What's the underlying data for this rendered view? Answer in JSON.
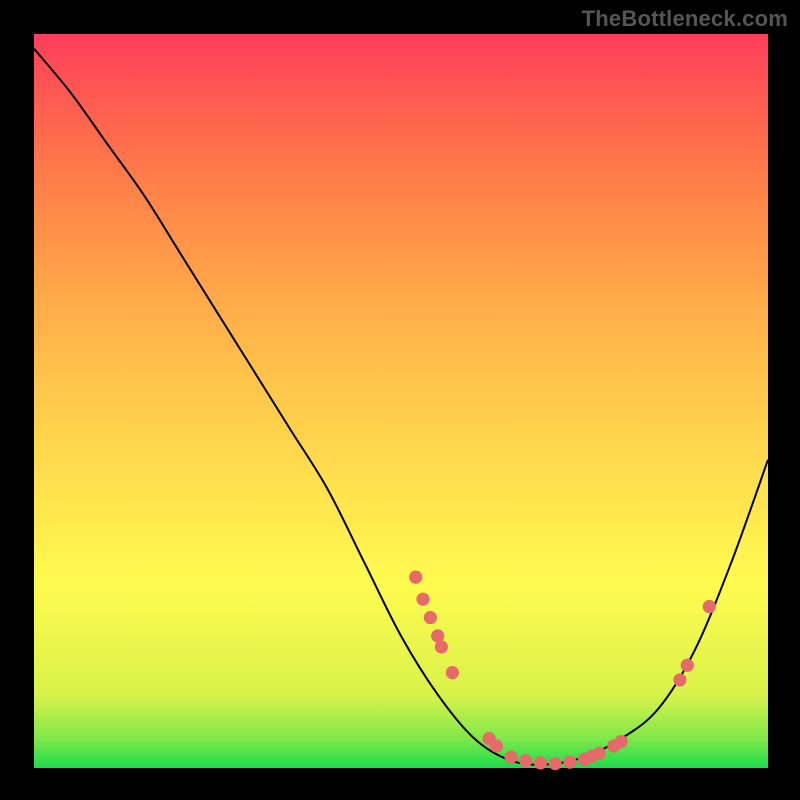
{
  "watermark": "TheBottleneck.com",
  "chart_data": {
    "type": "line",
    "title": "",
    "xlabel": "",
    "ylabel": "",
    "xlim": [
      0,
      100
    ],
    "ylim": [
      0,
      100
    ],
    "series": [
      {
        "name": "bottleneck-curve",
        "x": [
          0,
          5,
          10,
          15,
          20,
          25,
          30,
          35,
          40,
          45,
          50,
          55,
          60,
          65,
          70,
          75,
          80,
          85,
          90,
          95,
          100
        ],
        "values": [
          98,
          92,
          85,
          78,
          70,
          62,
          54,
          46,
          38,
          28,
          18,
          10,
          4,
          1,
          0.5,
          1.5,
          4,
          8,
          16,
          28,
          42
        ]
      }
    ],
    "points": [
      {
        "x": 52.0,
        "y": 26.0
      },
      {
        "x": 53.0,
        "y": 23.0
      },
      {
        "x": 54.0,
        "y": 20.5
      },
      {
        "x": 55.0,
        "y": 18.0
      },
      {
        "x": 55.5,
        "y": 16.5
      },
      {
        "x": 57.0,
        "y": 13.0
      },
      {
        "x": 62.0,
        "y": 4.0
      },
      {
        "x": 63.0,
        "y": 3.0
      },
      {
        "x": 65.0,
        "y": 1.5
      },
      {
        "x": 67.0,
        "y": 1.0
      },
      {
        "x": 69.0,
        "y": 0.7
      },
      {
        "x": 71.0,
        "y": 0.6
      },
      {
        "x": 73.0,
        "y": 0.8
      },
      {
        "x": 75.0,
        "y": 1.2
      },
      {
        "x": 76.0,
        "y": 1.6
      },
      {
        "x": 77.0,
        "y": 2.0
      },
      {
        "x": 79.0,
        "y": 3.0
      },
      {
        "x": 80.0,
        "y": 3.6
      },
      {
        "x": 88.0,
        "y": 12.0
      },
      {
        "x": 89.0,
        "y": 14.0
      },
      {
        "x": 92.0,
        "y": 22.0
      }
    ],
    "colors": {
      "curve": "#000000",
      "point": "#e66a6a"
    }
  }
}
